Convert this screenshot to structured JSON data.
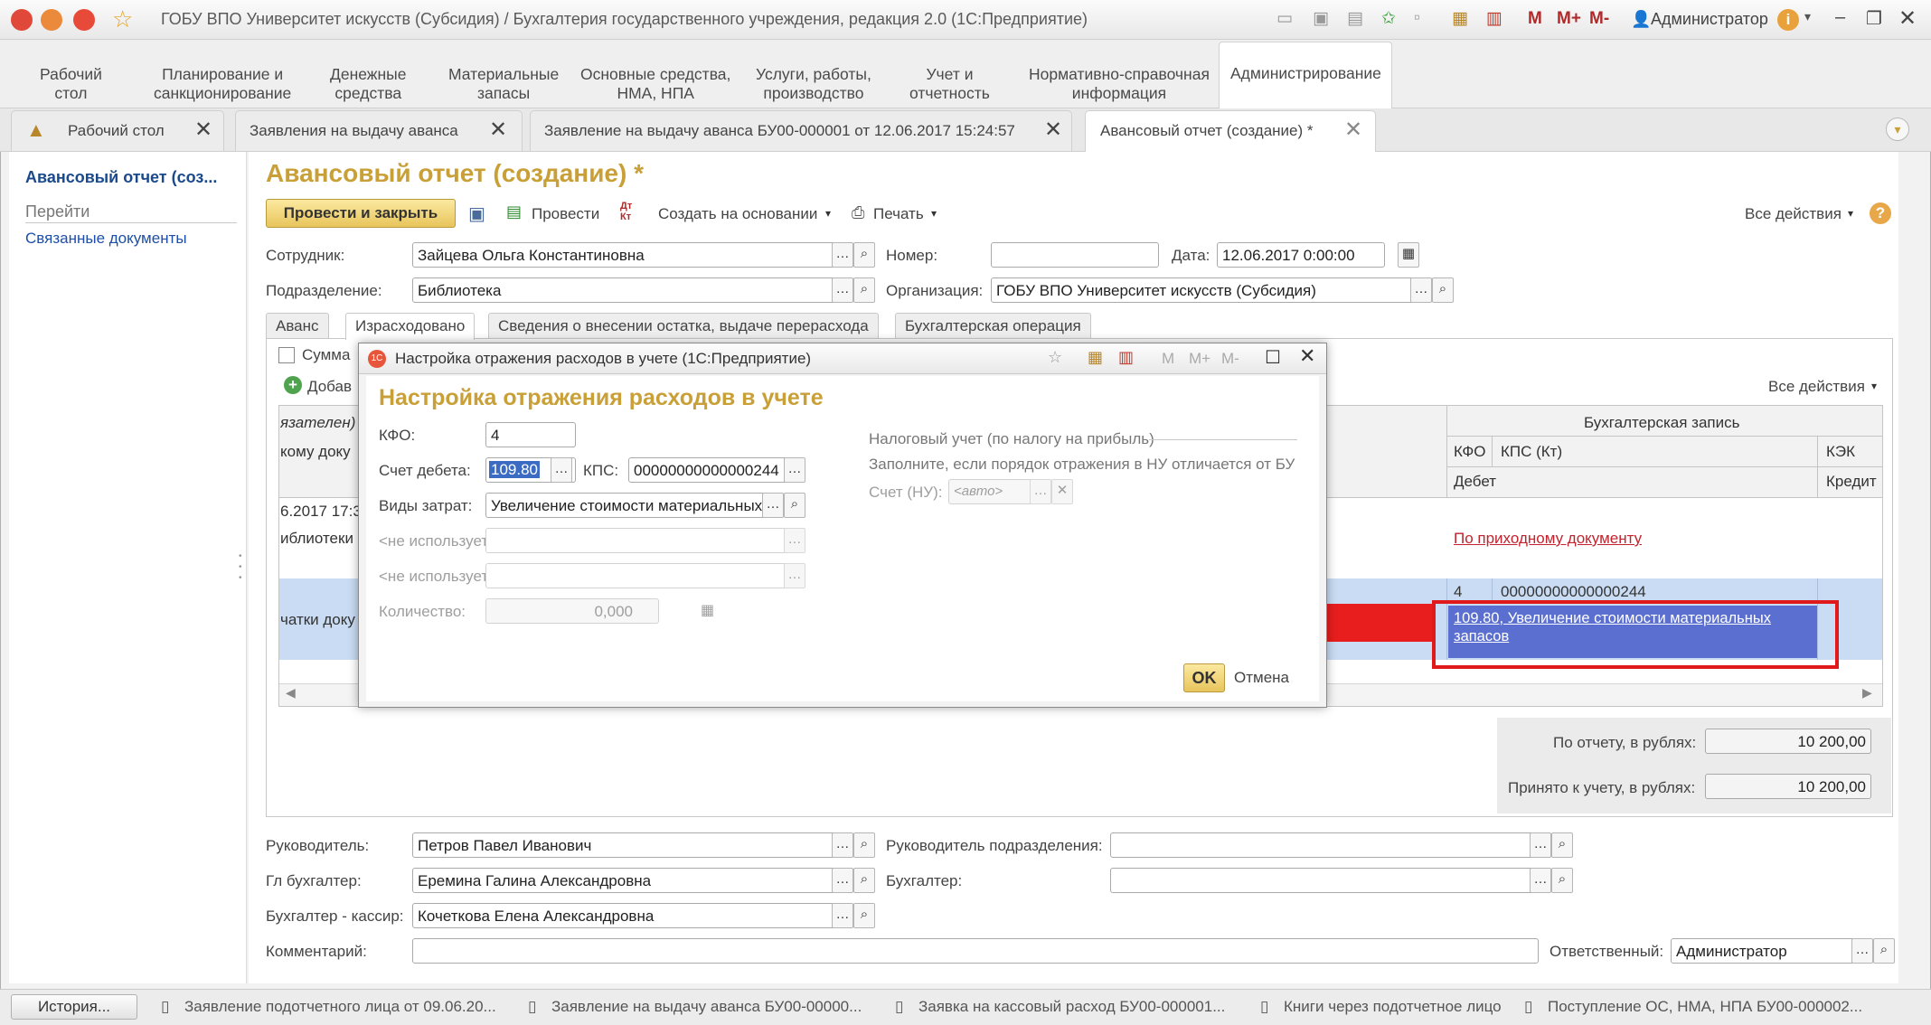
{
  "window": {
    "title": "ГОБУ ВПО Университет искусств (Субсидия) / Бухгалтерия государственного учреждения, редакция 2.0 (1С:Предприятие)",
    "toolbar": {
      "m": "M",
      "m_plus": "M+",
      "m_minus": "M-",
      "user": "Администратор"
    }
  },
  "sections": [
    {
      "label": "Рабочий\nстол"
    },
    {
      "label": "Планирование и\nсанкционирование"
    },
    {
      "label": "Денежные\nсредства"
    },
    {
      "label": "Материальные\nзапасы"
    },
    {
      "label": "Основные средства,\nНМА, НПА"
    },
    {
      "label": "Услуги, работы,\nпроизводство"
    },
    {
      "label": "Учет и\nотчетность"
    },
    {
      "label": "Нормативно-справочная\nинформация"
    },
    {
      "label": "Администрирование"
    }
  ],
  "open_tabs": [
    {
      "label": "Рабочий стол"
    },
    {
      "label": "Заявления на выдачу аванса"
    },
    {
      "label": "Заявление на выдачу аванса БУ00-000001 от 12.06.2017 15:24:57"
    },
    {
      "label": "Авансовый отчет (создание) *"
    }
  ],
  "left_panel": {
    "title": "Авансовый отчет (соз...",
    "goto": "Перейти",
    "related": "Связанные документы"
  },
  "form": {
    "title": "Авансовый отчет (создание) *",
    "buttons": {
      "post_close": "Провести и закрыть",
      "post": "Провести",
      "dtkt": "Дт\nКт",
      "create_based": "Создать на основании",
      "print": "Печать",
      "all_actions": "Все действия",
      "help": "?"
    },
    "employee_label": "Сотрудник:",
    "employee": "Зайцева Ольга Константиновна",
    "number_label": "Номер:",
    "number": "",
    "date_label": "Дата:",
    "date": "12.06.2017  0:00:00",
    "dept_label": "Подразделение:",
    "dept": "Библиотека",
    "org_label": "Организация:",
    "org": "ГОБУ ВПО Университет искусств (Субсидия)",
    "tabs": [
      "Аванс",
      "Израсходовано",
      "Сведения о внесении остатка, выдаче перерасхода",
      "Бухгалтерская операция"
    ],
    "sum_check": "Сумма",
    "add": "Добав",
    "grid_all_actions": "Все действия",
    "grid": {
      "col_left1": "язателен)",
      "col_left2": "кому доку",
      "row1_date": "6.2017 17:3",
      "row1_lib": "иблиотеки",
      "row2": "чатки доку",
      "acc_record": "Бухгалтерская запись",
      "kfo": "КФО",
      "kps": "КПС (Кт)",
      "kek": "КЭК",
      "debit": "Дебет",
      "credit": "Кредит",
      "link_incoming": "По приходному документу",
      "row2_kfo": "4",
      "row2_kps": "00000000000000244",
      "row2_link": "109.80, Увеличение стоимости материальных запасов"
    },
    "total_report_label": "По отчету, в рублях:",
    "total_report": "10 200,00",
    "total_accepted_label": "Принято к учету, в рублях:",
    "total_accepted": "10 200,00",
    "head_label": "Руководитель:",
    "head": "Петров Павел Иванович",
    "head_dept_label": "Руководитель подразделения:",
    "head_dept": "",
    "chief_acc_label": "Гл бухгалтер:",
    "chief_acc": "Еремина Галина Александровна",
    "acc_label": "Бухгалтер:",
    "acc": "",
    "cashier_label": "Бухгалтер - кассир:",
    "cashier": "Кочеткова Елена Александровна",
    "comment_label": "Комментарий:",
    "comment": "",
    "responsible_label": "Ответственный:",
    "responsible": "Администратор"
  },
  "dialog": {
    "window_title": "Настройка отражения расходов в учете  (1С:Предприятие)",
    "title": "Настройка отражения расходов в учете",
    "kfo_label": "КФО:",
    "kfo": "4",
    "debit_label": "Счет дебета:",
    "debit": "109.80",
    "kps_label": "КПС:",
    "kps": "00000000000000244",
    "cost_label": "Виды затрат:",
    "cost": "Увеличение стоимости материальных",
    "unused1": "<не используется>:",
    "unused2": "<не используется>:",
    "qty_label": "Количество:",
    "qty": "0,000",
    "tax_title": "Налоговый учет (по налогу на прибыль)",
    "tax_hint": "Заполните, если порядок отражения в НУ отличается от БУ",
    "tax_acc_label": "Счет (НУ):",
    "tax_acc_placeholder": "<авто>",
    "ok": "OK",
    "cancel": "Отмена",
    "m": "M",
    "m_plus": "M+",
    "m_minus": "M-"
  },
  "bottom": {
    "history": "История...",
    "items": [
      "Заявление подотчетного лица от 09.06.20...",
      "Заявление на выдачу аванса БУ00-00000...",
      "Заявка на кассовый расход БУ00-000001...",
      "Книги через подотчетное лицо",
      "Поступление ОС, НМА, НПА БУ00-000002..."
    ]
  },
  "colors": {
    "accent_title": "#c9a038",
    "highlight": "#5b6fd0",
    "arrow": "#e81e1e",
    "link": "#1e4ea8"
  }
}
